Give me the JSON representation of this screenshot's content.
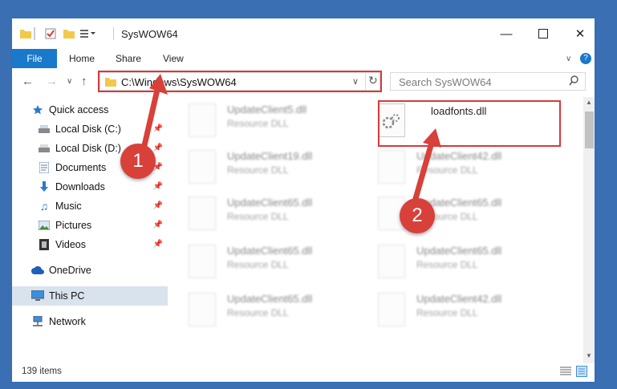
{
  "window": {
    "title": "SysWOW64"
  },
  "ribbon": {
    "tabs": [
      "File",
      "Home",
      "Share",
      "View"
    ]
  },
  "nav": {
    "address": "C:\\Windows\\SysWOW64",
    "search_placeholder": "Search SysWOW64"
  },
  "sidebar": {
    "items": [
      {
        "label": "Quick access",
        "icon": "star-icon"
      },
      {
        "label": "Local Disk (C:)",
        "icon": "drive-icon"
      },
      {
        "label": "Local Disk (D:)",
        "icon": "drive-icon"
      },
      {
        "label": "Documents",
        "icon": "documents-icon"
      },
      {
        "label": "Downloads",
        "icon": "downloads-icon"
      },
      {
        "label": "Music",
        "icon": "music-icon"
      },
      {
        "label": "Pictures",
        "icon": "pictures-icon"
      },
      {
        "label": "Videos",
        "icon": "videos-icon"
      },
      {
        "label": "OneDrive",
        "icon": "cloud-icon"
      },
      {
        "label": "This PC",
        "icon": "monitor-icon"
      },
      {
        "label": "Network",
        "icon": "network-icon"
      }
    ]
  },
  "files": {
    "left": [
      {
        "name": "UpdateClient5.dll",
        "type": "Resource DLL"
      },
      {
        "name": "UpdateClient19.dll",
        "type": "Resource DLL"
      },
      {
        "name": "UpdateClient65.dll",
        "type": "Resource DLL"
      },
      {
        "name": "UpdateClient65.dll",
        "type": "Resource DLL"
      },
      {
        "name": "UpdateClient65.dll",
        "type": "Resource DLL"
      }
    ],
    "right": [
      {
        "name": "loadfonts.dll",
        "type": ""
      },
      {
        "name": "UpdateClient42.dll",
        "type": "Resource DLL"
      },
      {
        "name": "UpdateClient65.dll",
        "type": "Resource DLL"
      },
      {
        "name": "UpdateClient65.dll",
        "type": "Resource DLL"
      },
      {
        "name": "UpdateClient42.dll",
        "type": "Resource DLL"
      }
    ]
  },
  "status": {
    "count": "139 items"
  },
  "markers": {
    "one": "1",
    "two": "2"
  },
  "colors": {
    "accent": "#1979ca",
    "highlight": "#d9383a",
    "selected": "#d9e3ee"
  }
}
